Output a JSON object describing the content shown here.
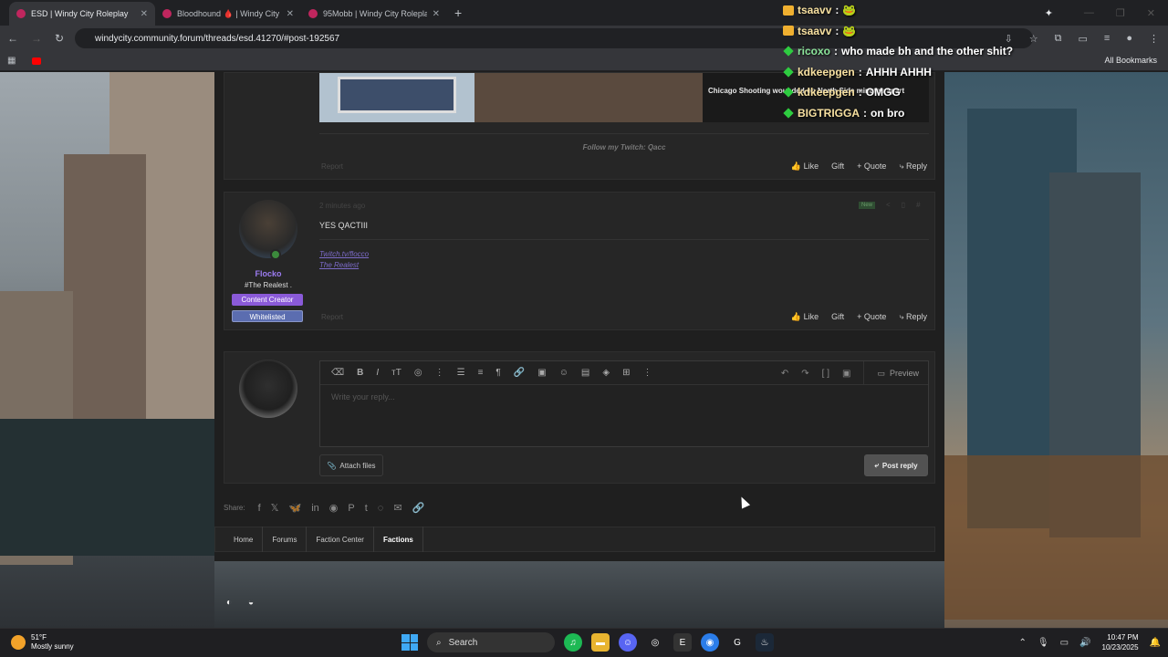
{
  "browser": {
    "tabs": [
      {
        "title": "ESD | Windy City Roleplay",
        "active": true
      },
      {
        "title": "Bloodhound 🩸 | Windy City R",
        "active": false
      },
      {
        "title": "95Mobb | Windy City Roleplay",
        "active": false
      }
    ],
    "url": "windycity.community.forum/threads/esd.41270/#post-192567",
    "bookmarks_label": "All Bookmarks"
  },
  "chat": [
    {
      "user": "tsaavv",
      "msg": "",
      "emote": "🐸",
      "icon": "sub"
    },
    {
      "user": "tsaavv",
      "msg": "",
      "emote": "🐸",
      "icon": "sub"
    },
    {
      "user": "ricoxo",
      "msg": "who made bh and the other shit?",
      "emote": "",
      "icon": "gem"
    },
    {
      "user": "kdkeepgen",
      "msg": "AHHH AHHH",
      "emote": "",
      "icon": "sub"
    },
    {
      "user": "kdkeepgen",
      "msg": "OMGG",
      "emote": "",
      "icon": "gem"
    },
    {
      "user": "BIGTRIGGA",
      "msg": "on bro",
      "emote": "",
      "icon": "gem"
    }
  ],
  "post1": {
    "image_headline": "Chicago Shooting wounded on North Side minutes apart",
    "signature": "Follow my Twitch: Qacc",
    "report": "Report",
    "actions": {
      "like": "Like",
      "gift": "Gift",
      "quote": "Quote",
      "reply": "Reply"
    }
  },
  "post2": {
    "time": "2 minutes ago",
    "new_tag": "New",
    "username": "Flocko",
    "user_title": "#The Realest .",
    "badges": [
      "Content Creator",
      "Whitelisted"
    ],
    "text": "YES QACTIII",
    "signature_lines": [
      "Twitch.tv/flocco",
      "The Realest"
    ],
    "report": "Report",
    "actions": {
      "like": "Like",
      "gift": "Gift",
      "quote": "Quote",
      "reply": "Reply"
    }
  },
  "reply": {
    "placeholder": "Write your reply...",
    "preview": "Preview",
    "attach": "Attach files",
    "post_reply": "Post reply"
  },
  "share": {
    "label": "Share:"
  },
  "breadcrumbs": [
    "Home",
    "Forums",
    "Faction Center",
    "Factions"
  ],
  "taskbar": {
    "temp": "51°F",
    "weather": "Mostly sunny",
    "search": "Search",
    "time": "10:47 PM",
    "date": "10/23/2025"
  }
}
